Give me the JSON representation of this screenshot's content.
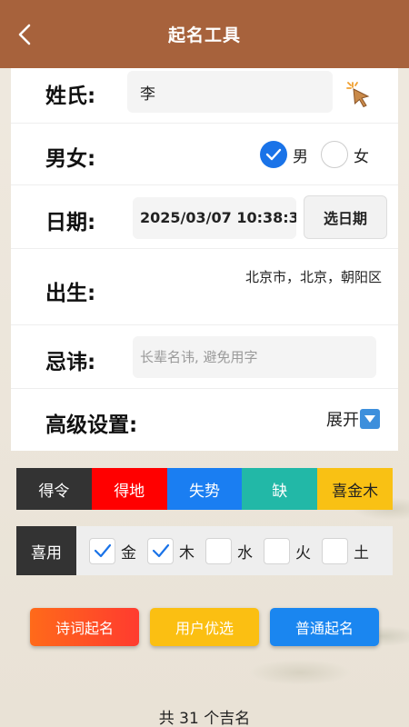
{
  "nav": {
    "title": "起名工具",
    "back_icon": "chevron-left-icon"
  },
  "form": {
    "surname": {
      "label": "姓氏:",
      "value": "李",
      "pick_icon": "tap-cursor-icon"
    },
    "gender": {
      "label": "男女:",
      "options": [
        {
          "label": "男",
          "selected": true
        },
        {
          "label": "女",
          "selected": false
        }
      ]
    },
    "date": {
      "label": "日期:",
      "value": "2025/03/07 10:38:3",
      "button": "选日期"
    },
    "birth": {
      "label": "出生:",
      "value": "北京市，北京，朝阳区"
    },
    "taboo": {
      "label": "忌讳:",
      "placeholder": "长辈名讳, 避免用字"
    },
    "advanced": {
      "label": "高级设置:",
      "toggle": "展开",
      "toggle_icon": "triangle-down-icon"
    }
  },
  "tags": [
    {
      "label": "得令",
      "bg": "#333333",
      "color": "#ffffff"
    },
    {
      "label": "得地",
      "bg": "#ff0000",
      "color": "#ffffff"
    },
    {
      "label": "失势",
      "bg": "#1a7ef2",
      "color": "#ffffff"
    },
    {
      "label": "缺",
      "bg": "#22b8a7",
      "color": "#ffffff"
    },
    {
      "label": "喜金木",
      "bg": "#f9c114",
      "color": "#222222"
    }
  ],
  "xiyong": {
    "label": "喜用",
    "elements": [
      {
        "label": "金",
        "checked": true
      },
      {
        "label": "木",
        "checked": true
      },
      {
        "label": "水",
        "checked": false
      },
      {
        "label": "火",
        "checked": false
      },
      {
        "label": "土",
        "checked": false
      }
    ]
  },
  "actions": [
    {
      "label": "诗词起名",
      "color": "#ff5a1f"
    },
    {
      "label": "用户优选",
      "color": "#fbbf12"
    },
    {
      "label": "普通起名",
      "color": "#1a86f0"
    }
  ],
  "result": {
    "count_text": "共 31 个吉名"
  },
  "colors": {
    "nav": "#a7623c",
    "accent": "#1a73e8"
  }
}
